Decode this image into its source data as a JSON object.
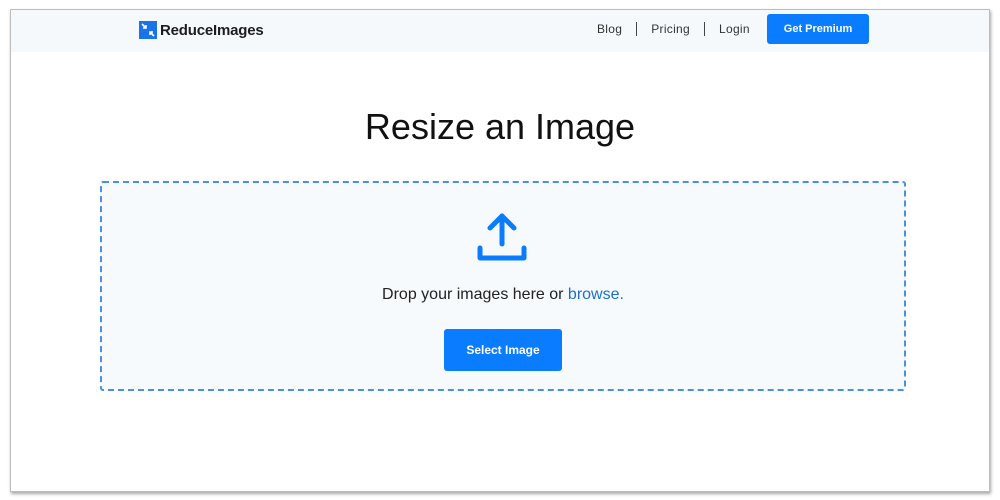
{
  "header": {
    "brand": "ReduceImages",
    "logo_icon": "compress-arrows-icon",
    "nav": [
      {
        "label": "Blog"
      },
      {
        "label": "Pricing"
      },
      {
        "label": "Login"
      }
    ],
    "cta_label": "Get Premium"
  },
  "main": {
    "title": "Resize an Image",
    "dropzone": {
      "icon": "upload-icon",
      "text": "Drop your images here or",
      "link": "browse.",
      "button_label": "Select Image"
    }
  },
  "colors": {
    "accent": "#0a7cff",
    "link": "#1a6fd1",
    "header_bg": "#f6f9fb",
    "dropzone_border": "#4a90e2"
  }
}
